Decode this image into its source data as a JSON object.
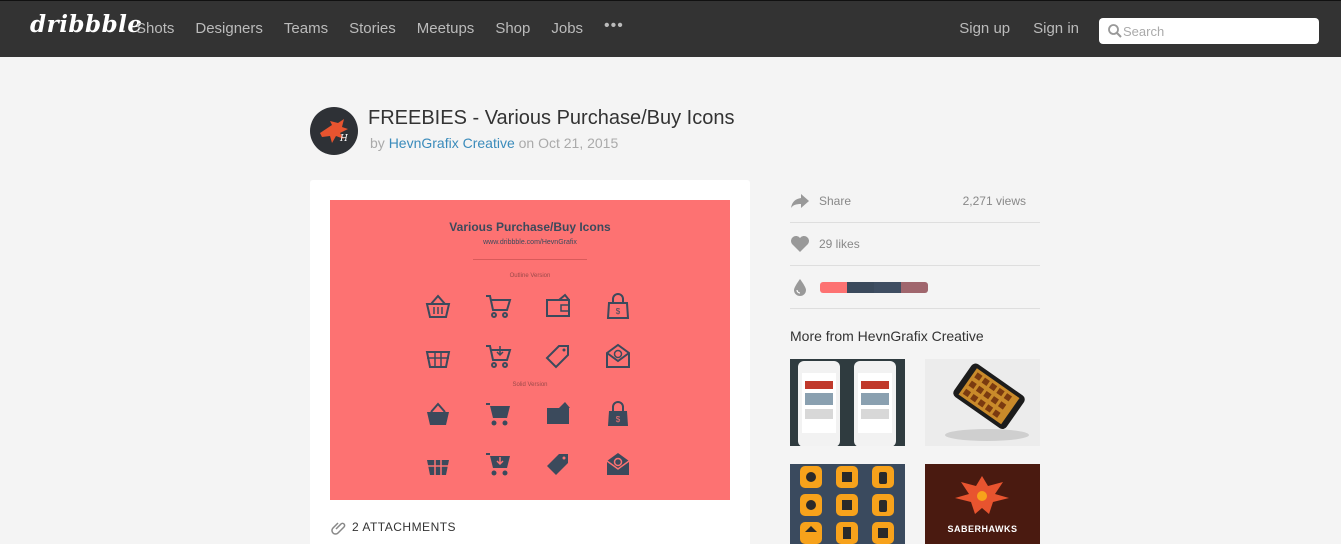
{
  "header": {
    "logo": "dribbble",
    "nav": [
      "Shots",
      "Designers",
      "Teams",
      "Stories",
      "Meetups",
      "Shop",
      "Jobs"
    ],
    "more_label": "•••",
    "sign_up": "Sign up",
    "sign_in": "Sign in",
    "search_placeholder": "Search"
  },
  "shot": {
    "title": "FREEBIES - Various Purchase/Buy Icons",
    "by_label": "by",
    "author": "HevnGrafix Creative",
    "on_label": "on",
    "date": "Oct 21, 2015",
    "image": {
      "title": "Various Purchase/Buy Icons",
      "url": "www.dribbble.com/HevnGrafix",
      "outline_label": "Outline Version",
      "solid_label": "Solid Version",
      "bg_color": "#fd7272",
      "icon_color": "#3b4a5c"
    },
    "attachments": "2 ATTACHMENTS"
  },
  "sidebar": {
    "share": "Share",
    "views": "2,271 views",
    "likes": "29 likes",
    "palette": [
      "#fd7272",
      "#3b4a5c",
      "#3f4e62",
      "#a0666d"
    ],
    "more_from": "More from HevnGrafix Creative",
    "thumb_texts": {
      "saberhawks": "SABERHAWKS"
    }
  }
}
